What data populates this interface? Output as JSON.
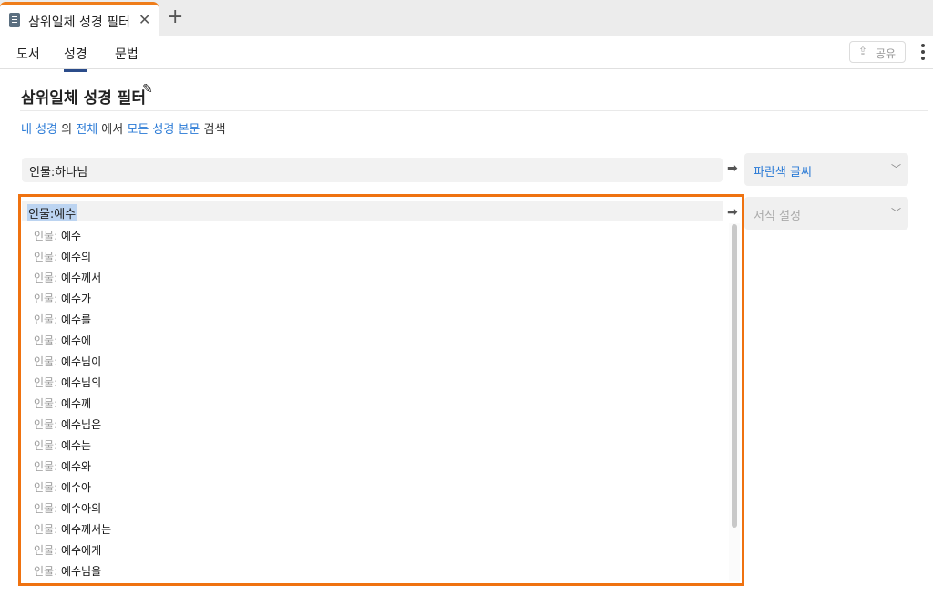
{
  "tab": {
    "title": "삼위일체 성경 필터",
    "close": "✕",
    "new_tab": "+"
  },
  "nav": {
    "tabs": [
      {
        "label": "도서"
      },
      {
        "label": "성경"
      },
      {
        "label": "문법"
      }
    ],
    "active": "성경",
    "share_label": "공유"
  },
  "page": {
    "title": "삼위일체 성경 필터"
  },
  "scope": {
    "part1": "내 성경",
    "part2": " 의 ",
    "part3": "전체",
    "part4": " 에서 ",
    "part5": "모든 성경 본문",
    "part6": " 검색"
  },
  "rules": [
    {
      "query": "인물:하나님",
      "style": "파란색 글씨",
      "style_color": "#2a7ad6"
    },
    {
      "query": "인물:예수",
      "style": "서식 설정",
      "style_color": "#aaaaaa"
    }
  ],
  "suggestions": {
    "prefix": "인물: ",
    "items": [
      "예수",
      "예수의",
      "예수께서",
      "예수가",
      "예수를",
      "예수에",
      "예수님이",
      "예수님의",
      "예수께",
      "예수님은",
      "예수는",
      "예수와",
      "예수아",
      "예수아의",
      "예수께서는",
      "예수에게",
      "예수님을"
    ]
  },
  "colors": {
    "accent": "#ef7210",
    "link": "#2a7ad6",
    "nav_active": "#2b4c8a"
  },
  "icons": {
    "doc": "document-icon",
    "close": "close-icon",
    "add": "plus-icon",
    "edit": "pencil-icon",
    "arrow": "arrow-right-icon",
    "menu": "kebab-menu-icon",
    "share": "upload-icon"
  }
}
